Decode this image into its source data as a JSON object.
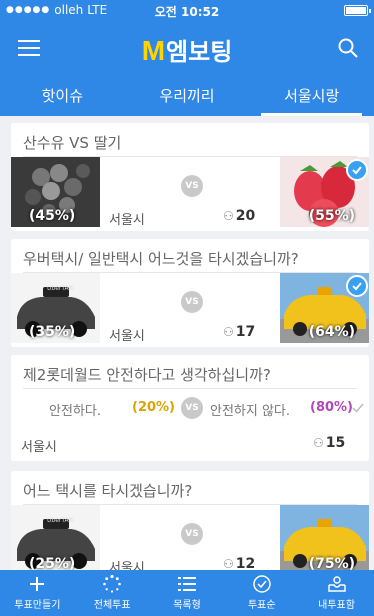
{
  "status": {
    "carrier": "olleh",
    "network": "LTE",
    "time": "오전 10:52"
  },
  "header": {
    "logo_m": "M",
    "logo_text": "엠보팅"
  },
  "tabs": [
    {
      "label": "핫이슈",
      "active": false
    },
    {
      "label": "우리끼리",
      "active": false
    },
    {
      "label": "서울시랑",
      "active": true
    }
  ],
  "polls": [
    {
      "question": "산수유 VS 딸기",
      "left_pct": "(45%)",
      "right_pct": "(55%)",
      "vs": "VS",
      "region": "서울시",
      "count": "20",
      "chosen": "right"
    },
    {
      "question": "우버택시/ 일반택시 어느것을 타시겠습니까?",
      "left_pct": "(35%)",
      "right_pct": "(64%)",
      "vs": "VS",
      "region": "서울시",
      "count": "17",
      "chosen": "right",
      "left_photo_text": "UberTAXI"
    },
    {
      "question": "제2롯데월드 안전하다고 생각하십니까?",
      "option_a": "안전하다.",
      "a_pct": "(20%)",
      "vs": "VS",
      "option_b": "안전하지 않다.",
      "b_pct": "(80%)",
      "region": "서울시",
      "count": "15"
    },
    {
      "question": "어느 택시를 타시겠습니까?",
      "left_pct": "(25%)",
      "right_pct": "(75%)",
      "vs": "VS",
      "region": "서울시",
      "count": "12",
      "left_photo_text": "UberTAXI"
    }
  ],
  "bottom_nav": [
    {
      "label": "투표만들기",
      "icon": "plus-icon"
    },
    {
      "label": "전체투표",
      "icon": "spinner-icon"
    },
    {
      "label": "목록형",
      "icon": "list-icon"
    },
    {
      "label": "투표순",
      "icon": "check-circle-icon"
    },
    {
      "label": "내투표함",
      "icon": "inbox-icon"
    }
  ],
  "colors": {
    "primary": "#2f87e6",
    "accent": "#ffd400",
    "pct_a": "#d9a400",
    "pct_b": "#b04ab8",
    "check": "#39a1f4"
  }
}
